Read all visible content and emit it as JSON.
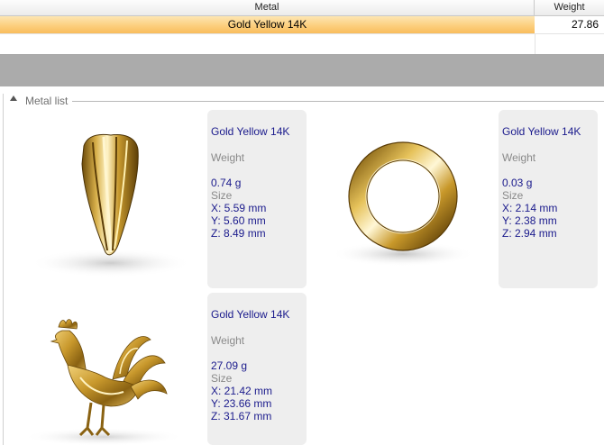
{
  "table": {
    "headers": {
      "metal": "Metal",
      "weight": "Weight"
    },
    "rows": [
      {
        "metal": "Gold Yellow 14K",
        "weight": "27.86"
      }
    ]
  },
  "group": {
    "label": "Metal list"
  },
  "items": [
    {
      "metal": "Gold Yellow 14K",
      "weight_label": "Weight",
      "weight": "0.74 g",
      "size_label": "Size",
      "x": "X: 5.59 mm",
      "y": "Y: 5.60 mm",
      "z": "Z: 8.49 mm",
      "thumb_icon": "gold-pendant-icon"
    },
    {
      "metal": "Gold Yellow 14K",
      "weight_label": "Weight",
      "weight": "0.03 g",
      "size_label": "Size",
      "x": "X: 2.14 mm",
      "y": "Y: 2.38 mm",
      "z": "Z: 2.94 mm",
      "thumb_icon": "gold-ring-icon"
    },
    {
      "metal": "Gold Yellow 14K",
      "weight_label": "Weight",
      "weight": "27.09 g",
      "size_label": "Size",
      "x": "X: 21.42 mm",
      "y": "Y: 23.66 mm",
      "z": "Z: 31.67 mm",
      "thumb_icon": "gold-rooster-icon"
    }
  ],
  "colors": {
    "selection": "#fccf7e",
    "accent_text": "#1a1a8c",
    "label_text": "#8a8a8a",
    "card_bg": "#eeeeee"
  }
}
